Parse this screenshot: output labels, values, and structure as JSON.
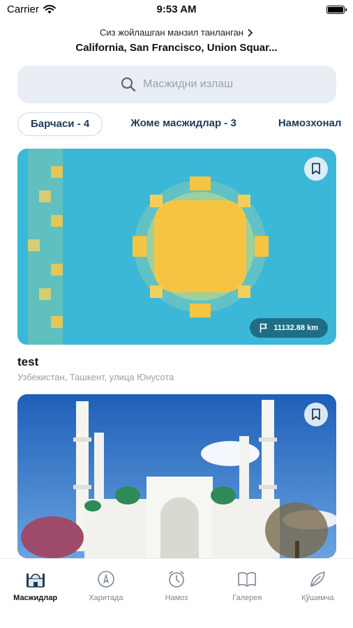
{
  "status_bar": {
    "carrier": "Carrier",
    "time": "9:53 AM"
  },
  "location": {
    "caption": "Сиз жойлашган манзил танланган",
    "address": "California, San Francisco, Union Squar..."
  },
  "search": {
    "placeholder": "Масжидни излаш"
  },
  "tabs": [
    {
      "label": "Барчаси - 4"
    },
    {
      "label": "Жоме масжидлар - 3"
    },
    {
      "label": "Намозхонал"
    }
  ],
  "cards": [
    {
      "title": "test",
      "address": "Узбекистан, Ташкент, улица Юнусота",
      "distance": "11132.88 km"
    },
    {
      "title": "",
      "address": ""
    }
  ],
  "bottom_nav": [
    {
      "label": "Масжидлар",
      "icon": "mosque-icon",
      "active": true
    },
    {
      "label": "Харитада",
      "icon": "map-icon"
    },
    {
      "label": "Намоз",
      "icon": "alarm-clock-icon"
    },
    {
      "label": "Галерея",
      "icon": "book-icon"
    },
    {
      "label": "Қўшимча",
      "icon": "leaf-icon"
    }
  ],
  "colors": {
    "accent": "#1f6d86",
    "tab_text": "#1f3a5a",
    "card1_bg": "#3bb8d8"
  }
}
